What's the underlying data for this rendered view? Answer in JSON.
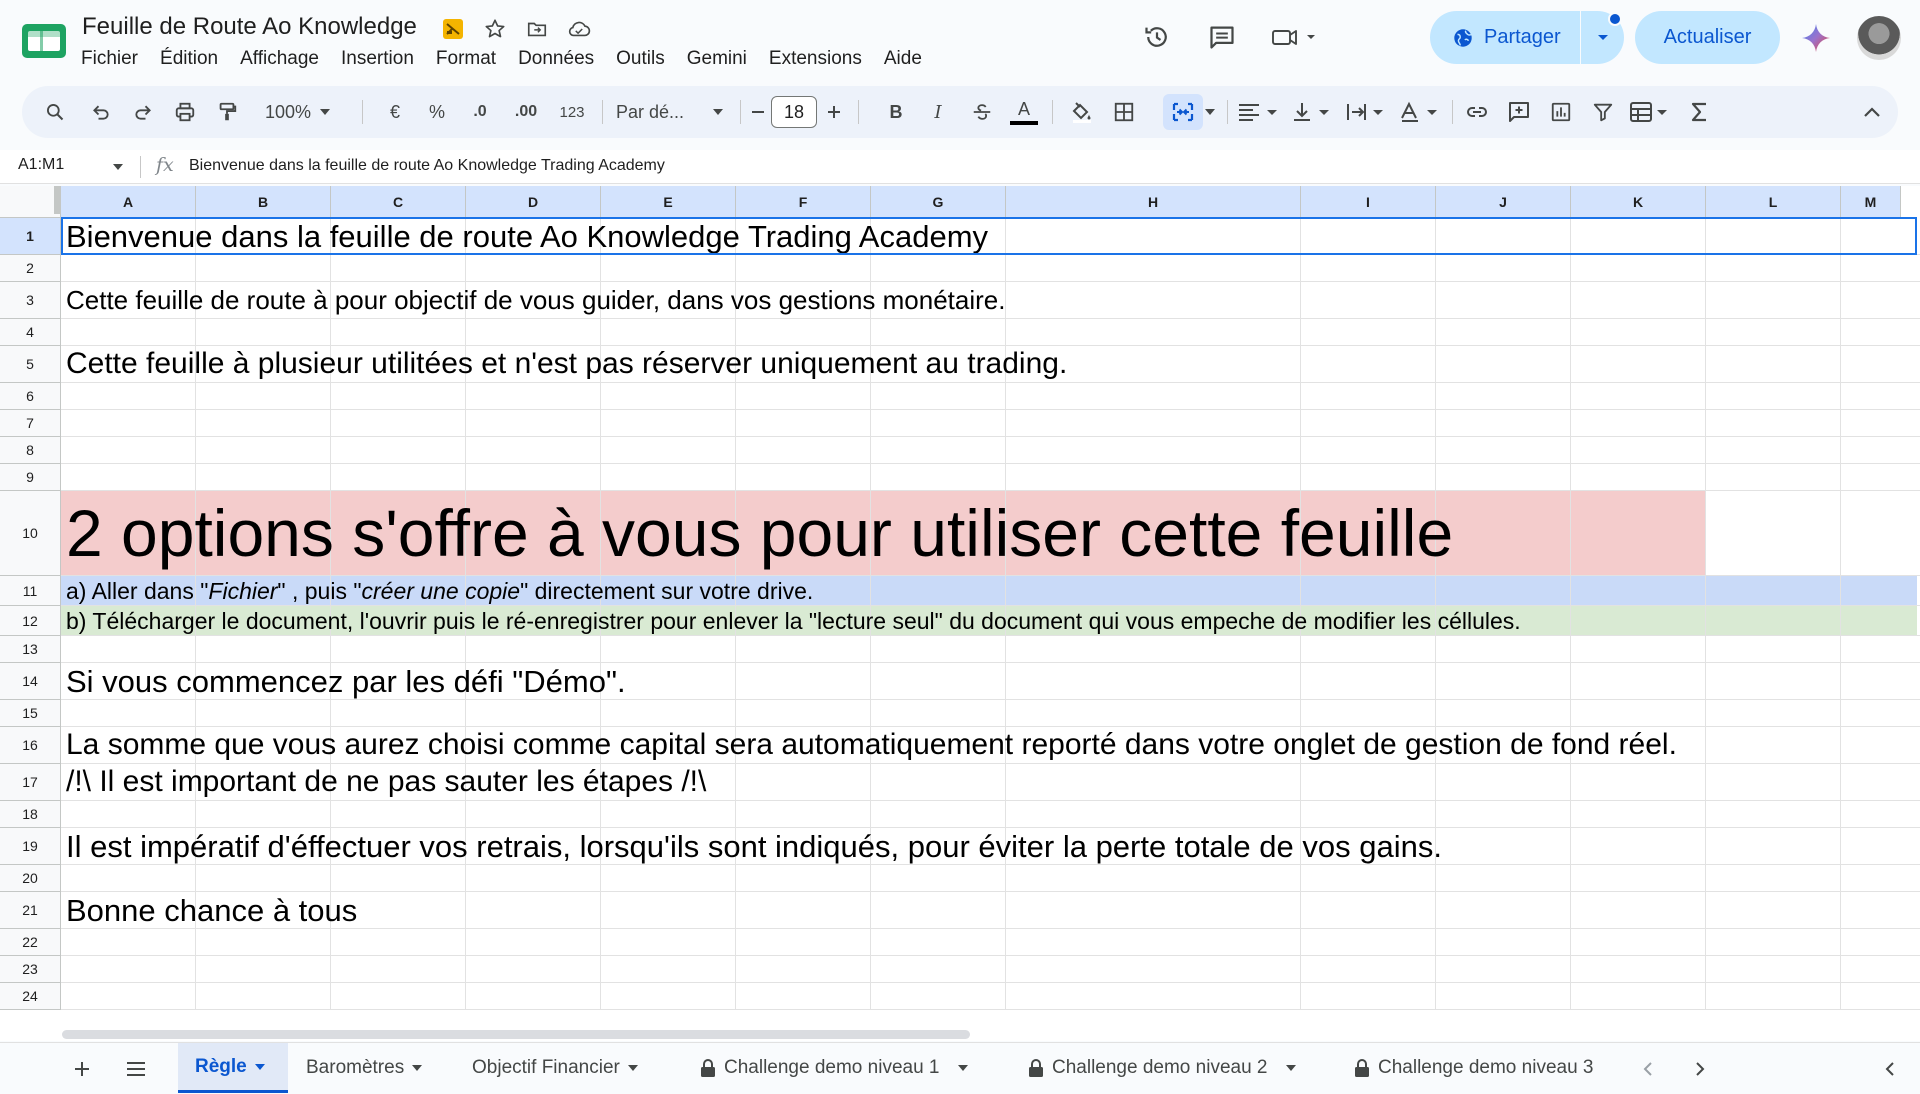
{
  "header": {
    "doc_title": "Feuille de Route Ao Knowledge",
    "menu": [
      "Fichier",
      "Édition",
      "Affichage",
      "Insertion",
      "Format",
      "Données",
      "Outils",
      "Gemini",
      "Extensions",
      "Aide"
    ],
    "share_label": "Partager",
    "update_label": "Actualiser"
  },
  "toolbar": {
    "zoom": "100%",
    "currency": "€",
    "percent": "%",
    "dec_decrease": ".0",
    "dec_increase": ".00",
    "number_format": "123",
    "font": "Par dé...",
    "font_size": "18",
    "bold": "B",
    "italic": "I",
    "text_color": "A"
  },
  "formula_bar": {
    "name_box": "A1:M1",
    "fx": "fx",
    "content": "Bienvenue dans la feuille de route Ao Knowledge Trading Academy"
  },
  "columns": [
    "A",
    "B",
    "C",
    "D",
    "E",
    "F",
    "G",
    "H",
    "I",
    "J",
    "K",
    "L",
    "M"
  ],
  "rows": [
    "1",
    "2",
    "3",
    "4",
    "5",
    "6",
    "7",
    "8",
    "9",
    "10",
    "11",
    "12",
    "13",
    "14",
    "15",
    "16",
    "17",
    "18",
    "19",
    "20",
    "21",
    "22",
    "23",
    "24"
  ],
  "cells": {
    "r1": "Bienvenue dans la feuille de route Ao Knowledge Trading Academy",
    "r3": "Cette feuille de route à pour objectif de vous guider, dans vos gestions monétaire.",
    "r5": "Cette feuille à plusieur utilitées et n'est pas réserver uniquement au trading.",
    "r10": "2 options s'offre à vous pour utiliser cette feuille",
    "r11": [
      "a)  Aller dans \"",
      "Fichier",
      "\" , puis \"",
      "créer une copie",
      "\" directement sur votre drive."
    ],
    "r12": "b) Télécharger le document, l'ouvrir puis le ré-enregistrer pour enlever la \"lecture seul\" du document qui vous empeche de modifier les céllules.",
    "r14": "Si vous commencez par les défi \"Démo\".",
    "r16": "La somme que vous aurez choisi comme capital sera automatiquement reporté dans votre onglet de gestion de fond réel.",
    "r17": "/!\\ Il est important de ne pas sauter les étapes /!\\",
    "r19": "Il est impératif d'éffectuer vos retrais, lorsqu'ils sont indiqués, pour éviter la perte totale de vos gains.",
    "r21": "Bonne chance à tous"
  },
  "fills": {
    "r10": "#f4cccc",
    "r11": "#c9daf8",
    "r12": "#d9ead3"
  },
  "sheets": [
    {
      "label": "Règle",
      "active": true,
      "locked": false
    },
    {
      "label": "Baromètres",
      "active": false,
      "locked": false
    },
    {
      "label": "Objectif Financier",
      "active": false,
      "locked": false
    },
    {
      "label": "Challenge  demo niveau 1",
      "active": false,
      "locked": true
    },
    {
      "label": "Challenge  demo niveau 2",
      "active": false,
      "locked": true
    },
    {
      "label": "Challenge  demo niveau 3",
      "active": false,
      "locked": true
    }
  ]
}
